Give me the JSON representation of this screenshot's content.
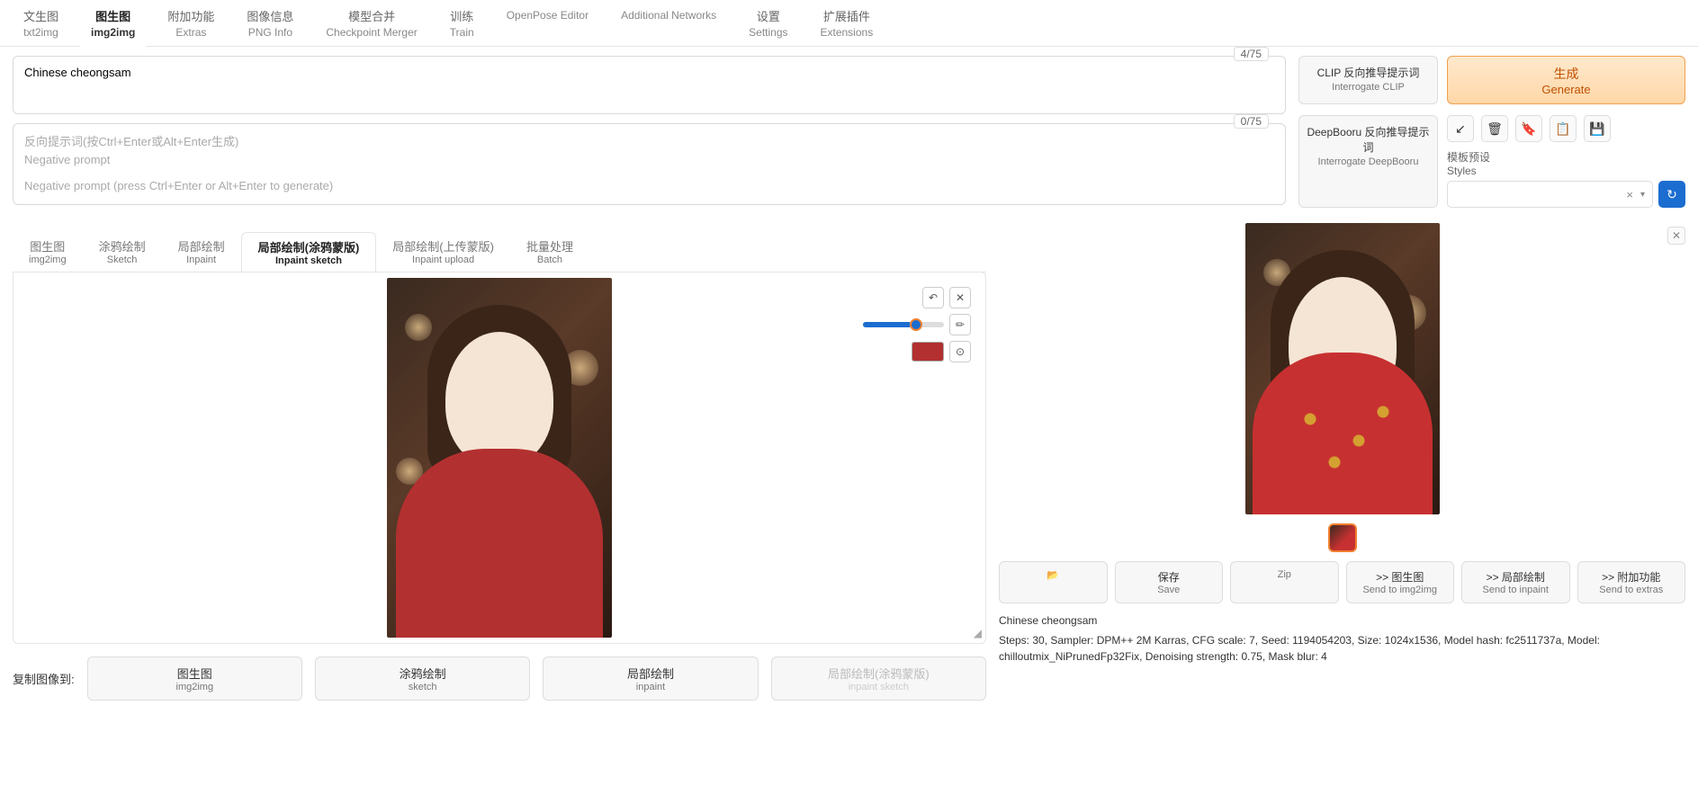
{
  "top_tabs": [
    {
      "cn": "文生图",
      "en": "txt2img"
    },
    {
      "cn": "图生图",
      "en": "img2img"
    },
    {
      "cn": "附加功能",
      "en": "Extras"
    },
    {
      "cn": "图像信息",
      "en": "PNG Info"
    },
    {
      "cn": "模型合并",
      "en": "Checkpoint Merger"
    },
    {
      "cn": "训练",
      "en": "Train"
    },
    {
      "cn": "",
      "en": "OpenPose Editor"
    },
    {
      "cn": "",
      "en": "Additional Networks"
    },
    {
      "cn": "设置",
      "en": "Settings"
    },
    {
      "cn": "扩展插件",
      "en": "Extensions"
    }
  ],
  "top_tab_active": 1,
  "prompt": {
    "value": "Chinese cheongsam",
    "token_count": "4/75"
  },
  "neg_prompt": {
    "placeholder_cn": "反向提示词(按Ctrl+Enter或Alt+Enter生成)",
    "placeholder_en1": "Negative prompt",
    "placeholder_en2": "Negative prompt (press Ctrl+Enter or Alt+Enter to generate)",
    "token_count": "0/75"
  },
  "interrogate_clip": {
    "cn": "CLIP 反向推导提示词",
    "en": "Interrogate CLIP"
  },
  "interrogate_deep": {
    "cn": "DeepBooru 反向推导提示词",
    "en": "Interrogate DeepBooru"
  },
  "generate": {
    "cn": "生成",
    "en": "Generate"
  },
  "styles": {
    "cn": "模板预设",
    "en": "Styles",
    "clear": "×",
    "chev": "▾"
  },
  "sub_tabs": [
    {
      "cn": "图生图",
      "en": "img2img"
    },
    {
      "cn": "涂鸦绘制",
      "en": "Sketch"
    },
    {
      "cn": "局部绘制",
      "en": "Inpaint"
    },
    {
      "cn": "局部绘制(涂鸦蒙版)",
      "en": "Inpaint sketch"
    },
    {
      "cn": "局部绘制(上传蒙版)",
      "en": "Inpaint upload"
    },
    {
      "cn": "批量处理",
      "en": "Batch"
    }
  ],
  "sub_tab_active": 3,
  "brush_color": "#b33030",
  "copy_label": "复制图像到:",
  "copy_btns": [
    {
      "cn": "图生图",
      "en": "img2img",
      "disabled": false
    },
    {
      "cn": "涂鸦绘制",
      "en": "sketch",
      "disabled": false
    },
    {
      "cn": "局部绘制",
      "en": "inpaint",
      "disabled": false
    },
    {
      "cn": "局部绘制(涂鸦蒙版)",
      "en": "inpaint sketch",
      "disabled": true
    }
  ],
  "out_btns": [
    {
      "cn": "",
      "en": "📂",
      "icon": true
    },
    {
      "cn": "保存",
      "en": "Save"
    },
    {
      "cn": "",
      "en": "Zip"
    },
    {
      "cn": ">> 图生图",
      "en": "Send to img2img"
    },
    {
      "cn": ">> 局部绘制",
      "en": "Send to inpaint"
    },
    {
      "cn": ">> 附加功能",
      "en": "Send to extras"
    }
  ],
  "gen_info": {
    "prompt": "Chinese cheongsam",
    "params": "Steps: 30, Sampler: DPM++ 2M Karras, CFG scale: 7, Seed: 1194054203, Size: 1024x1536, Model hash: fc2511737a, Model: chilloutmix_NiPrunedFp32Fix, Denoising strength: 0.75, Mask blur: 4"
  }
}
